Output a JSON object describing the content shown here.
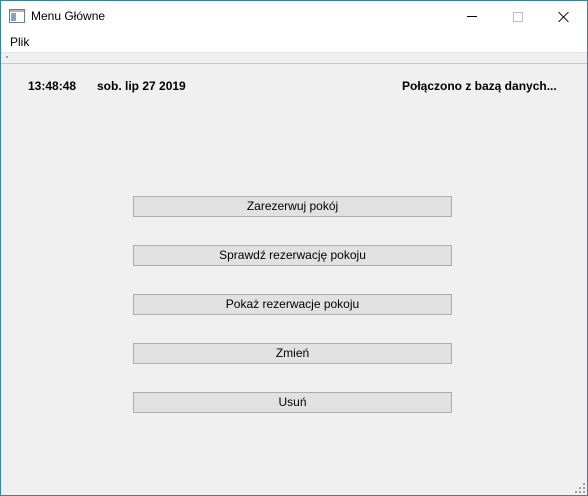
{
  "window": {
    "title": "Menu Główne"
  },
  "menubar": {
    "items": [
      {
        "label": "Plik"
      }
    ]
  },
  "status": {
    "time": "13:48:48",
    "date": "sob. lip 27 2019",
    "connection": "Połączono z bazą danych..."
  },
  "actions": [
    {
      "label": "Zarezerwuj pokój"
    },
    {
      "label": "Sprawdź rezerwację pokoju"
    },
    {
      "label": "Pokaż rezerwacje pokoju"
    },
    {
      "label": "Zmień"
    },
    {
      "label": "Usuń"
    }
  ],
  "colors": {
    "window_border": "#3c7fb1",
    "client_background": "#f0f0f0",
    "button_face": "#e1e1e1",
    "button_border": "#adadad"
  },
  "icons": {
    "app": "app-window-icon",
    "minimize": "minimize-icon",
    "maximize": "maximize-icon",
    "close": "close-icon",
    "resize": "resize-grip-icon"
  }
}
